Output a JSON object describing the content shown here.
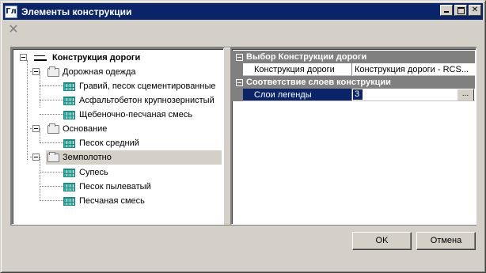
{
  "window": {
    "title": "Элементы конструкции",
    "app_icon_text": "Гл",
    "accent_color": "#0a246a"
  },
  "toolbar": {
    "close_icon": "close-icon"
  },
  "tree": {
    "root": "Конструкция дороги",
    "groups": [
      {
        "label": "Дорожная одежда",
        "items": [
          "Гравий, песок сцементированные",
          "Асфальтобетон крупнозернистый",
          "Щебеночно-песчаная смесь"
        ]
      },
      {
        "label": "Основание",
        "items": [
          "Песок средний"
        ]
      },
      {
        "label": "Земполотно",
        "items": [
          "Супесь",
          "Песок пылеватый",
          "Песчаная смесь"
        ]
      }
    ]
  },
  "properties": {
    "category1": "Выбор Конструкции дороги",
    "row1_name": "Конструкция дороги",
    "row1_value": "Конструкция дороги - RCS...",
    "category2": "Соответствие слоев конструкции",
    "row2_name": "Слои легенды",
    "row2_value": "3",
    "ellipsis": "..."
  },
  "buttons": {
    "ok": "OK",
    "cancel": "Отмена"
  }
}
